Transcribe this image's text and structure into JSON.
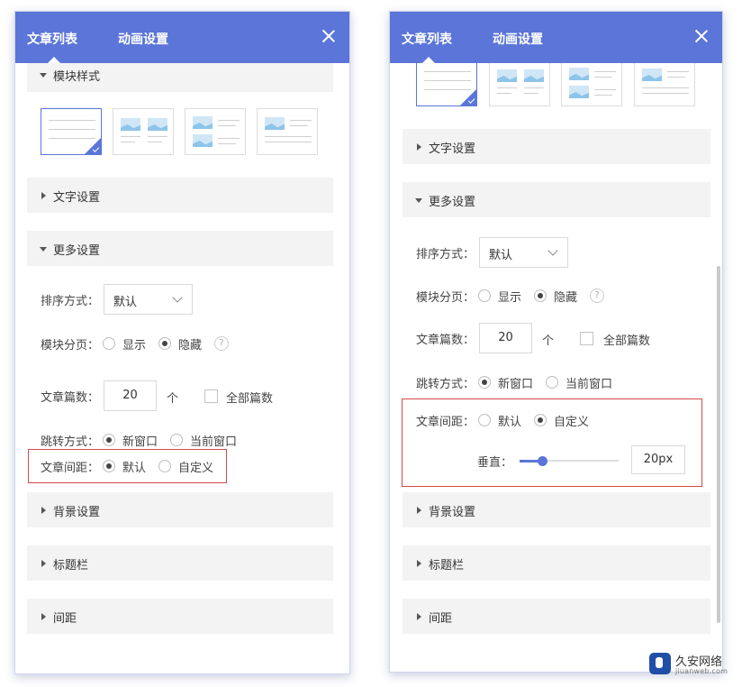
{
  "colors": {
    "accent": "#5b75d8",
    "header_bg": "#5b75d8",
    "section_bg": "#f3f3f4",
    "highlight_border": "#d44a4a"
  },
  "panel_left": {
    "tabs": [
      "文章列表",
      "动画设置"
    ],
    "sections": {
      "style": "模块样式",
      "text": "文字设置",
      "more": "更多设置",
      "background": "背景设置",
      "title_bar": "标题栏",
      "spacing": "间距"
    },
    "sort": {
      "label": "排序方式：",
      "value": "默认"
    },
    "pagination": {
      "label": "模块分页：",
      "show": "显示",
      "hide": "隐藏",
      "selected": "隐藏",
      "help": "?"
    },
    "count": {
      "label": "文章篇数：",
      "value": "20",
      "unit": "个",
      "all_label": "全部篇数"
    },
    "jump": {
      "label": "跳转方式：",
      "new_window": "新窗口",
      "current_window": "当前窗口",
      "selected": "新窗口"
    },
    "gap": {
      "label": "文章间距：",
      "default": "默认",
      "custom": "自定义",
      "selected": "默认"
    }
  },
  "panel_right": {
    "tabs": [
      "文章列表",
      "动画设置"
    ],
    "sections": {
      "text": "文字设置",
      "more": "更多设置",
      "background": "背景设置",
      "title_bar": "标题栏",
      "spacing": "间距"
    },
    "sort": {
      "label": "排序方式：",
      "value": "默认"
    },
    "pagination": {
      "label": "模块分页：",
      "show": "显示",
      "hide": "隐藏",
      "selected": "隐藏",
      "help": "?"
    },
    "count": {
      "label": "文章篇数：",
      "value": "20",
      "unit": "个",
      "all_label": "全部篇数"
    },
    "jump": {
      "label": "跳转方式：",
      "new_window": "新窗口",
      "current_window": "当前窗口",
      "selected": "新窗口"
    },
    "gap": {
      "label": "文章间距：",
      "default": "默认",
      "custom": "自定义",
      "selected": "自定义"
    },
    "vertical": {
      "label": "垂直：",
      "value": "20px",
      "slider_fraction": 0.23
    }
  },
  "watermark": {
    "name": "久安网络",
    "domain": "jiuanweb.com"
  }
}
